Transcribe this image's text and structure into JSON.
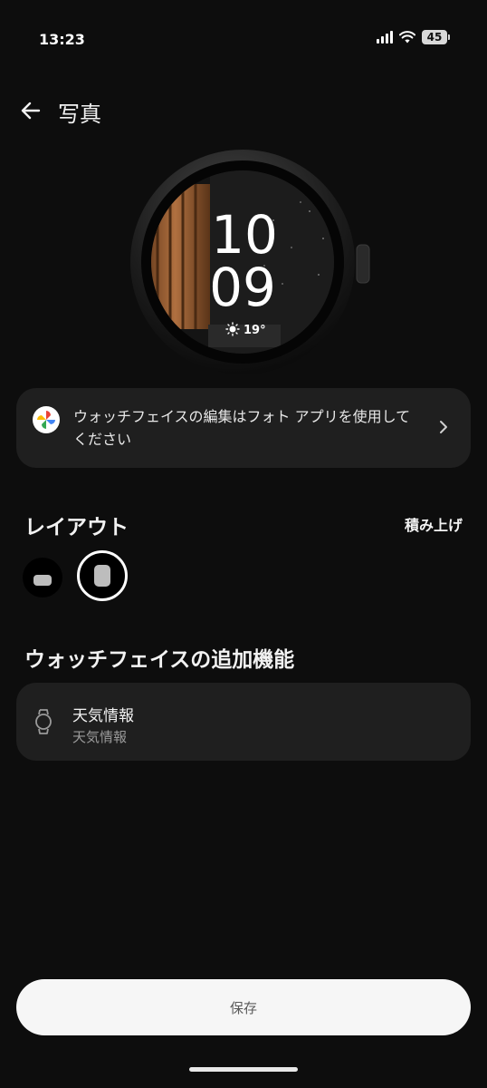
{
  "status": {
    "time": "13:23",
    "battery": "45"
  },
  "header": {
    "title": "写真"
  },
  "watch": {
    "hour": "10",
    "minute": "09",
    "temperature": "19°"
  },
  "info_card": {
    "text": "ウォッチフェイスの編集はフォト アプリを使用してください"
  },
  "layout_section": {
    "title": "レイアウト",
    "selected_value": "積み上げ",
    "options": [
      "horizontal-pill-layout",
      "stacked-layout"
    ],
    "selected_index": 1
  },
  "features_section": {
    "title": "ウォッチフェイスの追加機能",
    "items": [
      {
        "title": "天気情報",
        "subtitle": "天気情報",
        "icon": "watch-icon"
      }
    ]
  },
  "save_label": "保存",
  "colors": {
    "background": "#0d0d0d",
    "card": "#1f1f1f",
    "save_button": "#f6f6f6"
  }
}
